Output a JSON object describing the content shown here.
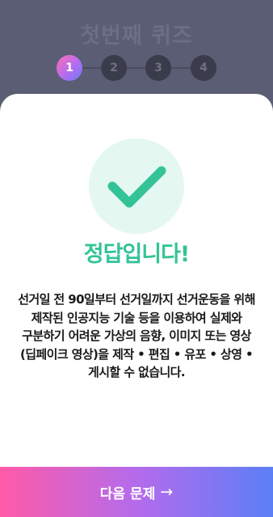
{
  "header": {
    "title": "첫번째 퀴즈"
  },
  "stepper": {
    "steps": [
      {
        "label": "1",
        "active": true
      },
      {
        "label": "2",
        "active": false
      },
      {
        "label": "3",
        "active": false
      },
      {
        "label": "4",
        "active": false
      }
    ]
  },
  "result": {
    "icon": "check-icon",
    "title": "정답입니다!",
    "explanation": "선거일 전 90일부터 선거일까지 선거운동을 위해 제작된 인공지능 기술 등을 이용하여 실제와 구분하기 어려운 가상의 음향, 이미지 또는 영상 (딥페이크 영상)을 제작 • 편집 • 유포 • 상영 • 게시할 수 없습니다."
  },
  "footer": {
    "next_label": "다음 문제",
    "next_icon": "arrow-right-icon"
  },
  "colors": {
    "accent_green": "#34c397",
    "background": "#5b5d74",
    "gradient_start": "#ff5aa8",
    "gradient_end": "#5c7ff5"
  }
}
